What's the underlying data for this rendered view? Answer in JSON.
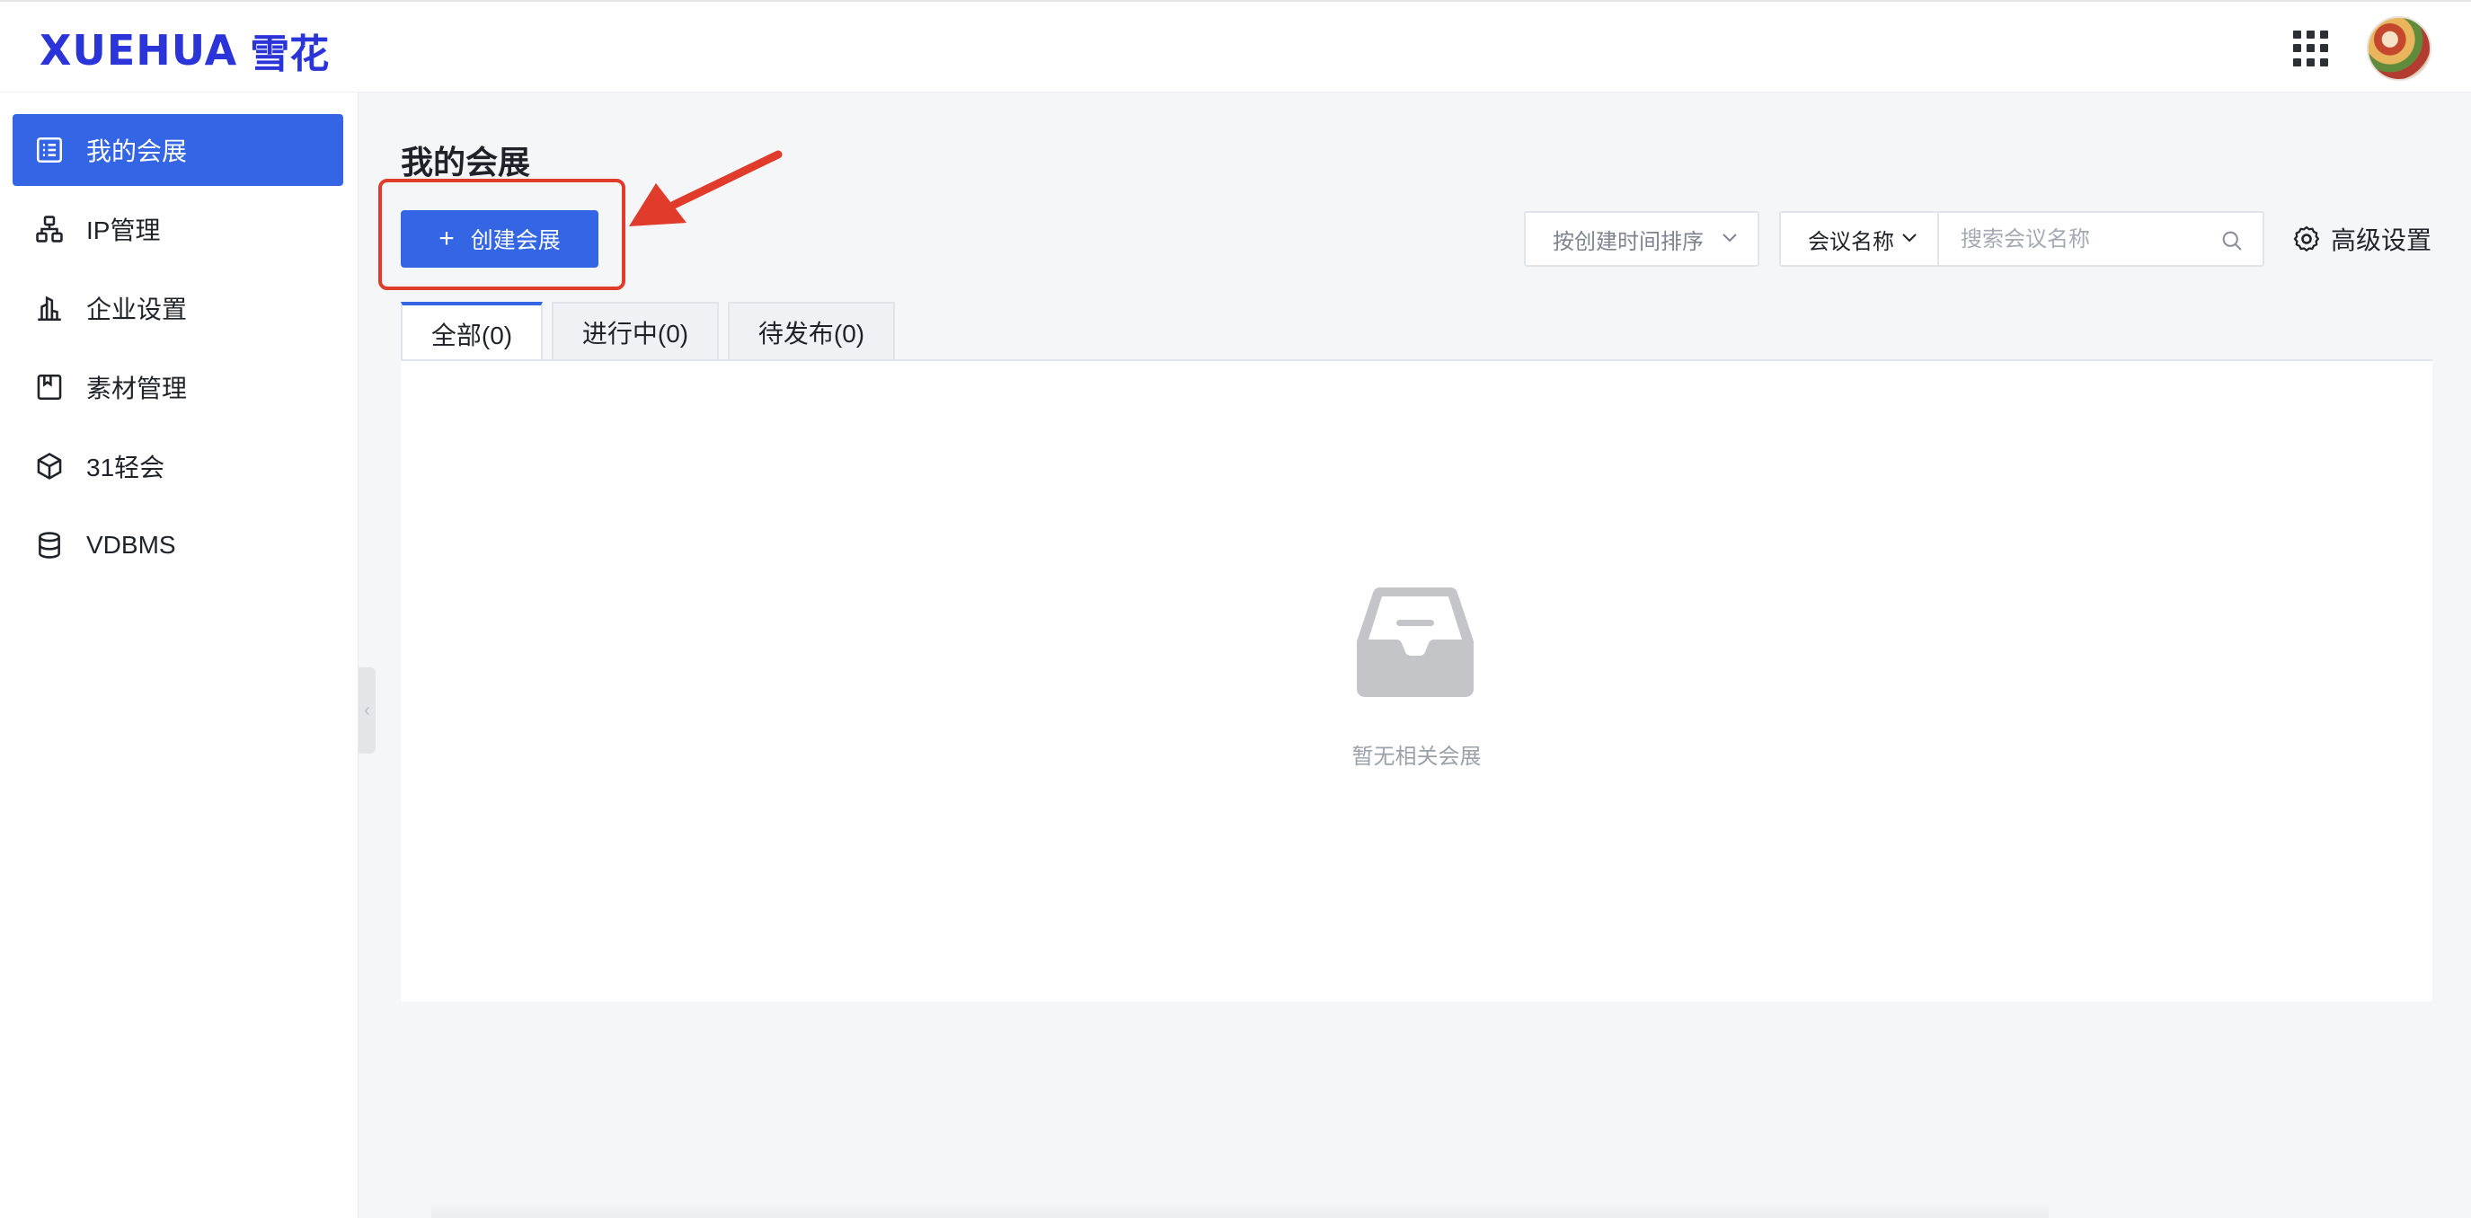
{
  "brand": {
    "latin": "XUEHUA",
    "cn": "雪花",
    "color": "#2a34d8"
  },
  "header": {
    "apps_icon": "grid-icon",
    "avatar": "user-avatar"
  },
  "sidebar": {
    "items": [
      {
        "label": "我的会展",
        "icon": "list-icon",
        "active": true
      },
      {
        "label": "IP管理",
        "icon": "hierarchy-icon",
        "active": false
      },
      {
        "label": "企业设置",
        "icon": "building-icon",
        "active": false
      },
      {
        "label": "素材管理",
        "icon": "bookmark-box-icon",
        "active": false
      },
      {
        "label": "31轻会",
        "icon": "cube-icon",
        "active": false
      },
      {
        "label": "VDBMS",
        "icon": "database-icon",
        "active": false
      }
    ]
  },
  "main": {
    "title": "我的会展",
    "create_button": {
      "icon": "plus-icon",
      "label": "创建会展"
    },
    "sort_select": {
      "value": "按创建时间排序"
    },
    "field_select": {
      "value": "会议名称"
    },
    "search": {
      "placeholder": "搜索会议名称",
      "value": ""
    },
    "advanced_settings": {
      "label": "高级设置",
      "icon": "gear-icon"
    },
    "tabs": [
      {
        "label": "全部(0)",
        "active": true
      },
      {
        "label": "进行中(0)",
        "active": false
      },
      {
        "label": "待发布(0)",
        "active": false
      }
    ],
    "empty_state": {
      "icon": "inbox-icon",
      "text": "暂无相关会展"
    }
  },
  "annotation": {
    "highlight_color": "#e03b2b"
  },
  "colors": {
    "primary": "#3365e4",
    "background": "#f5f6f8"
  }
}
